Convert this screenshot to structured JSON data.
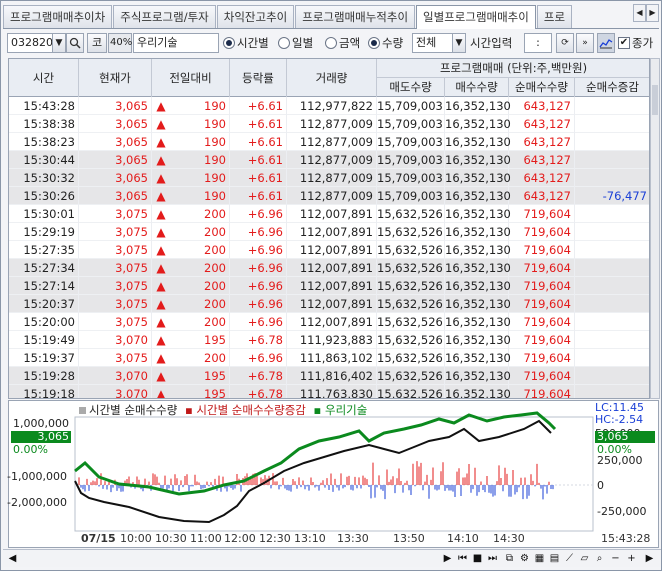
{
  "tabs": [
    "프로그램매매추이차",
    "주식프로그램/투자",
    "차익잔고추이",
    "프로그램매매누적추이",
    "일별프로그램매매추이",
    "프로"
  ],
  "active_tab": 4,
  "toolbar": {
    "stock_code": "032820",
    "market_button": "코",
    "ratio_badge": "40%",
    "stock_name": "우리기술",
    "radio_time": "시간별",
    "radio_daily": "일별",
    "radio_amount": "금액",
    "radio_quantity": "수량",
    "filter_value": "전체",
    "time_input_label": "시간입력",
    "time_input_value": ":",
    "checkbox_label": "종가"
  },
  "table": {
    "headers": {
      "time": "시간",
      "price": "현재가",
      "change": "전일대비",
      "rate": "등락률",
      "volume": "거래량",
      "program": "프로그램매매 (단위:주,백만원)",
      "sell": "매도수량",
      "buy": "매수수량",
      "net": "순매수수량",
      "net_change": "순매수증감"
    },
    "rows": [
      {
        "time": "15:43:28",
        "price": "3,065",
        "change": "190",
        "rate": "+6.61",
        "volume": "112,977,822",
        "sell": "15,709,003",
        "buy": "16,352,130",
        "net": "643,127",
        "net_change": ""
      },
      {
        "time": "15:38:38",
        "price": "3,065",
        "change": "190",
        "rate": "+6.61",
        "volume": "112,877,009",
        "sell": "15,709,003",
        "buy": "16,352,130",
        "net": "643,127",
        "net_change": ""
      },
      {
        "time": "15:38:23",
        "price": "3,065",
        "change": "190",
        "rate": "+6.61",
        "volume": "112,877,009",
        "sell": "15,709,003",
        "buy": "16,352,130",
        "net": "643,127",
        "net_change": ""
      },
      {
        "time": "15:30:44",
        "price": "3,065",
        "change": "190",
        "rate": "+6.61",
        "volume": "112,877,009",
        "sell": "15,709,003",
        "buy": "16,352,130",
        "net": "643,127",
        "net_change": ""
      },
      {
        "time": "15:30:32",
        "price": "3,065",
        "change": "190",
        "rate": "+6.61",
        "volume": "112,877,009",
        "sell": "15,709,003",
        "buy": "16,352,130",
        "net": "643,127",
        "net_change": ""
      },
      {
        "time": "15:30:26",
        "price": "3,065",
        "change": "190",
        "rate": "+6.61",
        "volume": "112,877,009",
        "sell": "15,709,003",
        "buy": "16,352,130",
        "net": "643,127",
        "net_change": "-76,477"
      },
      {
        "time": "15:30:01",
        "price": "3,075",
        "change": "200",
        "rate": "+6.96",
        "volume": "112,007,891",
        "sell": "15,632,526",
        "buy": "16,352,130",
        "net": "719,604",
        "net_change": ""
      },
      {
        "time": "15:29:19",
        "price": "3,075",
        "change": "200",
        "rate": "+6.96",
        "volume": "112,007,891",
        "sell": "15,632,526",
        "buy": "16,352,130",
        "net": "719,604",
        "net_change": ""
      },
      {
        "time": "15:27:35",
        "price": "3,075",
        "change": "200",
        "rate": "+6.96",
        "volume": "112,007,891",
        "sell": "15,632,526",
        "buy": "16,352,130",
        "net": "719,604",
        "net_change": ""
      },
      {
        "time": "15:27:34",
        "price": "3,075",
        "change": "200",
        "rate": "+6.96",
        "volume": "112,007,891",
        "sell": "15,632,526",
        "buy": "16,352,130",
        "net": "719,604",
        "net_change": ""
      },
      {
        "time": "15:27:14",
        "price": "3,075",
        "change": "200",
        "rate": "+6.96",
        "volume": "112,007,891",
        "sell": "15,632,526",
        "buy": "16,352,130",
        "net": "719,604",
        "net_change": ""
      },
      {
        "time": "15:20:37",
        "price": "3,075",
        "change": "200",
        "rate": "+6.96",
        "volume": "112,007,891",
        "sell": "15,632,526",
        "buy": "16,352,130",
        "net": "719,604",
        "net_change": ""
      },
      {
        "time": "15:20:00",
        "price": "3,075",
        "change": "200",
        "rate": "+6.96",
        "volume": "112,007,891",
        "sell": "15,632,526",
        "buy": "16,352,130",
        "net": "719,604",
        "net_change": ""
      },
      {
        "time": "15:19:49",
        "price": "3,070",
        "change": "195",
        "rate": "+6.78",
        "volume": "111,923,883",
        "sell": "15,632,526",
        "buy": "16,352,130",
        "net": "719,604",
        "net_change": ""
      },
      {
        "time": "15:19:37",
        "price": "3,075",
        "change": "200",
        "rate": "+6.96",
        "volume": "111,863,102",
        "sell": "15,632,526",
        "buy": "16,352,130",
        "net": "719,604",
        "net_change": ""
      },
      {
        "time": "15:19:28",
        "price": "3,070",
        "change": "195",
        "rate": "+6.78",
        "volume": "111,816,402",
        "sell": "15,632,526",
        "buy": "16,352,130",
        "net": "719,604",
        "net_change": ""
      },
      {
        "time": "15:19:18",
        "price": "3,070",
        "change": "195",
        "rate": "+6.78",
        "volume": "111,763,830",
        "sell": "15,632,526",
        "buy": "16,352,130",
        "net": "719,604",
        "net_change": ""
      }
    ]
  },
  "chart": {
    "legend": [
      "시간별 순매수수량",
      "시간별 순매수수량증감",
      "우리기술"
    ],
    "left_axis": [
      "1,000,000",
      "-1,000,000",
      "-2,000,000"
    ],
    "left_tag_price": "3,065",
    "left_tag_rate": "0.00%",
    "right_lc": "LC:11.45",
    "right_hc": "HC:-2.54",
    "right_axis": [
      "500,000",
      "250,000",
      "0",
      "-250,000"
    ],
    "right_tag_price": "3,065",
    "right_tag_rate": "0.00%",
    "x_labels": [
      "07/15",
      "10:00",
      "10:30",
      "11:00",
      "12:00",
      "12:30",
      "13:10",
      "13:30",
      "13:50",
      "14:10",
      "14:30",
      "15:43:28"
    ]
  },
  "colors": {
    "up": "#e31b1b",
    "down": "#1a3fd6",
    "price_line": "#0b8a1e",
    "net_line": "#111111"
  }
}
